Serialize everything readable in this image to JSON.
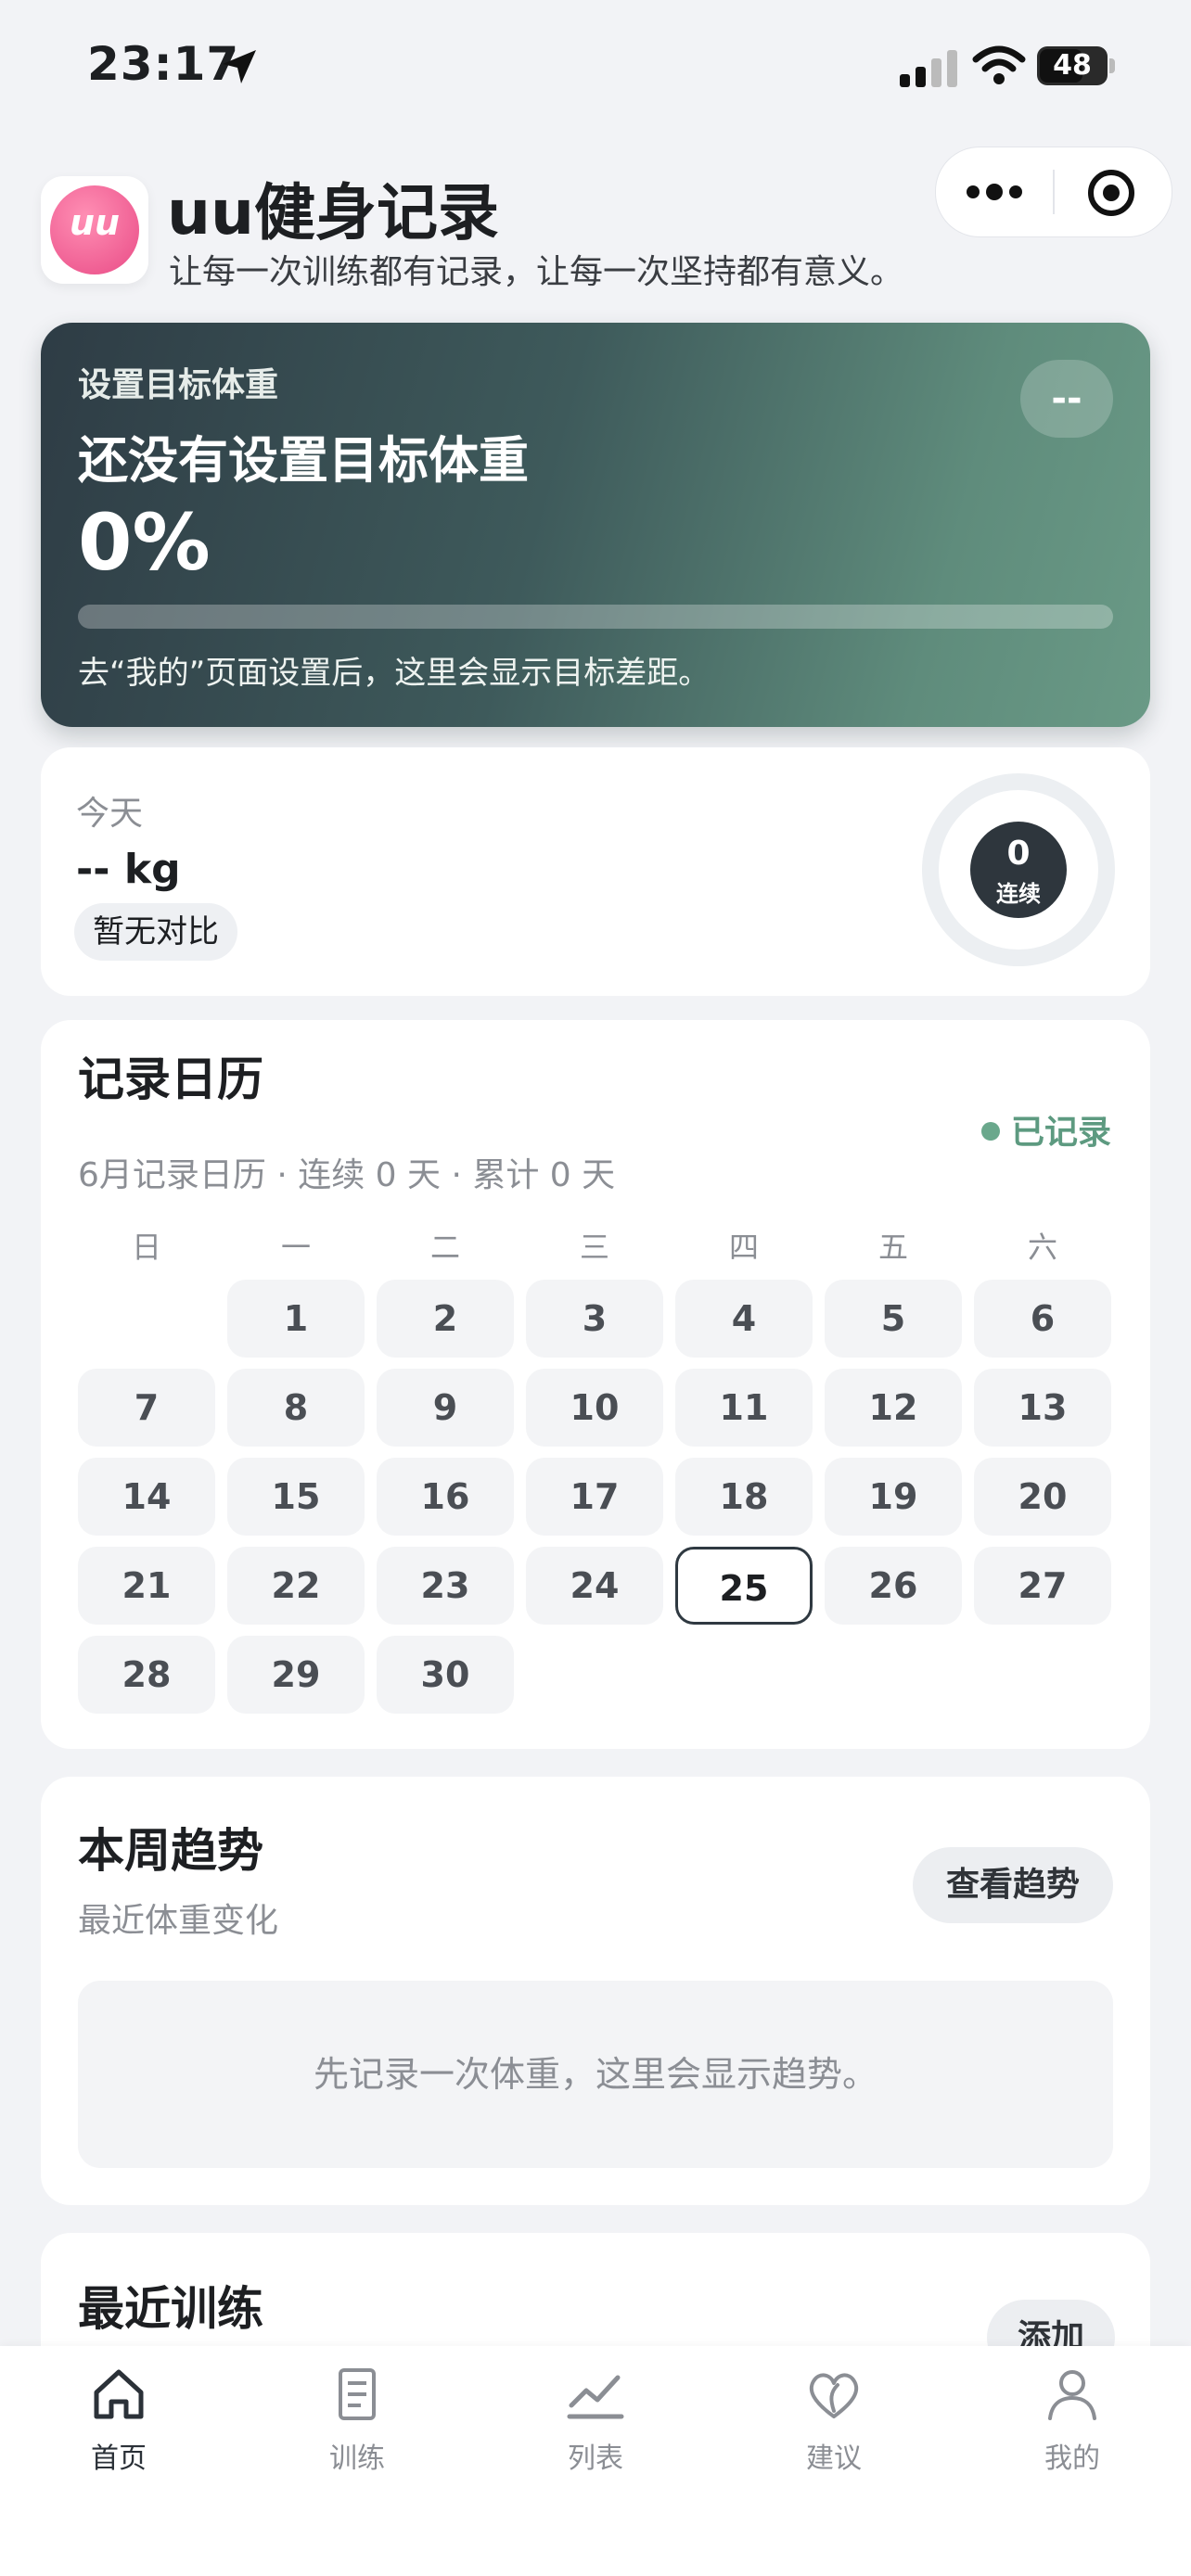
{
  "status_bar": {
    "time": "23:17",
    "battery": "48"
  },
  "header": {
    "logo_text": "uu",
    "title": "uu健身记录",
    "subtitle": "让每一次训练都有记录，让每一次坚持都有意义。"
  },
  "goal_card": {
    "label": "设置目标体重",
    "title": "还没有设置目标体重",
    "percent": "0%",
    "progress": 0,
    "hint": "去“我的”页面设置后，这里会显示目标差距。",
    "badge": "--"
  },
  "today_card": {
    "label": "今天",
    "weight": "-- kg",
    "compare": "暂无对比",
    "streak_count": "0",
    "streak_label": "连续"
  },
  "calendar": {
    "title": "记录日历",
    "subtitle": "6月记录日历 · 连续 0 天 · 累计 0 天",
    "legend": "已记录",
    "weekdays": [
      "日",
      "一",
      "二",
      "三",
      "四",
      "五",
      "六"
    ],
    "first_weekday_index": 1,
    "days": [
      "1",
      "2",
      "3",
      "4",
      "5",
      "6",
      "7",
      "8",
      "9",
      "10",
      "11",
      "12",
      "13",
      "14",
      "15",
      "16",
      "17",
      "18",
      "19",
      "20",
      "21",
      "22",
      "23",
      "24",
      "25",
      "26",
      "27",
      "28",
      "29",
      "30"
    ],
    "today": "25"
  },
  "trend": {
    "title": "本周趋势",
    "subtitle": "最近体重变化",
    "button": "查看趋势",
    "empty_text": "先记录一次体重，这里会显示趋势。"
  },
  "recent": {
    "title": "最近训练",
    "button": "添加"
  },
  "tabbar": {
    "items": [
      {
        "label": "首页",
        "icon": "home-icon",
        "active": true
      },
      {
        "label": "训练",
        "icon": "document-icon",
        "active": false
      },
      {
        "label": "列表",
        "icon": "chart-line-icon",
        "active": false
      },
      {
        "label": "建议",
        "icon": "heart-leaf-icon",
        "active": false
      },
      {
        "label": "我的",
        "icon": "user-icon",
        "active": false
      }
    ]
  },
  "colors": {
    "accent_green": "#5d9a80",
    "goal_gradient_start": "#2e3c45",
    "goal_gradient_end": "#6a9a86",
    "logo_pink": "#e94b86"
  }
}
